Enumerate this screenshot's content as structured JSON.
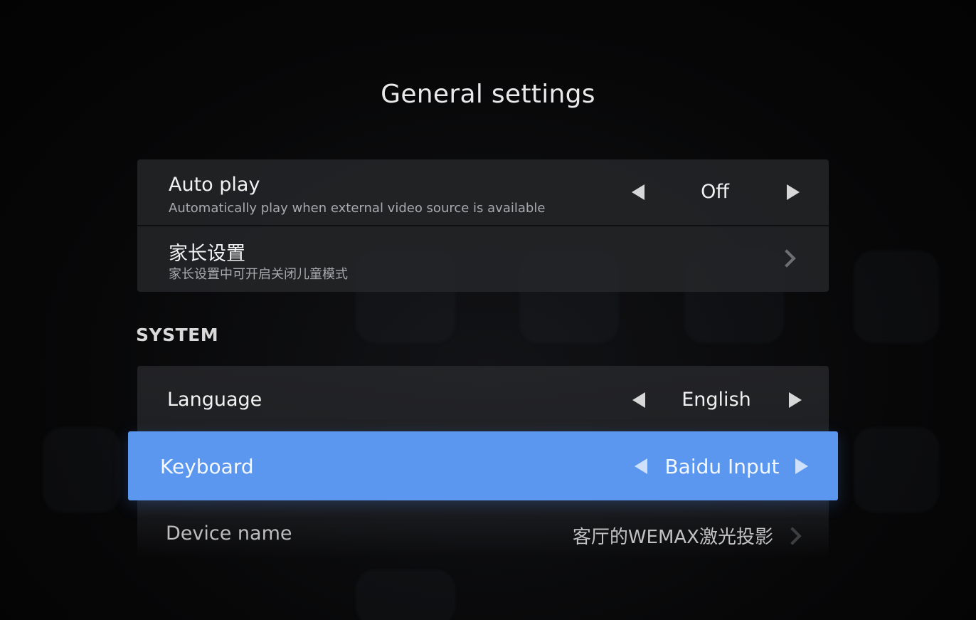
{
  "page": {
    "title": "General settings"
  },
  "top_panel": {
    "auto_play": {
      "title": "Auto play",
      "subtitle": "Automatically play when external video source is available",
      "value": "Off"
    },
    "parental": {
      "title": "家长设置",
      "subtitle": "家长设置中可开启关闭儿童模式"
    }
  },
  "system_section": {
    "header": "SYSTEM",
    "language": {
      "title": "Language",
      "value": "English"
    },
    "keyboard": {
      "title": "Keyboard",
      "value": "Baidu Input",
      "selected": true
    },
    "device_name": {
      "title": "Device name",
      "value": "客厅的WEMAX激光投影"
    }
  },
  "colors": {
    "highlight": "#5b97ef",
    "background": "#050506",
    "panel": "#26272a"
  },
  "icons": {
    "left_arrow": "triangle-left-icon",
    "right_arrow": "triangle-right-icon",
    "chevron": "chevron-right-icon"
  }
}
